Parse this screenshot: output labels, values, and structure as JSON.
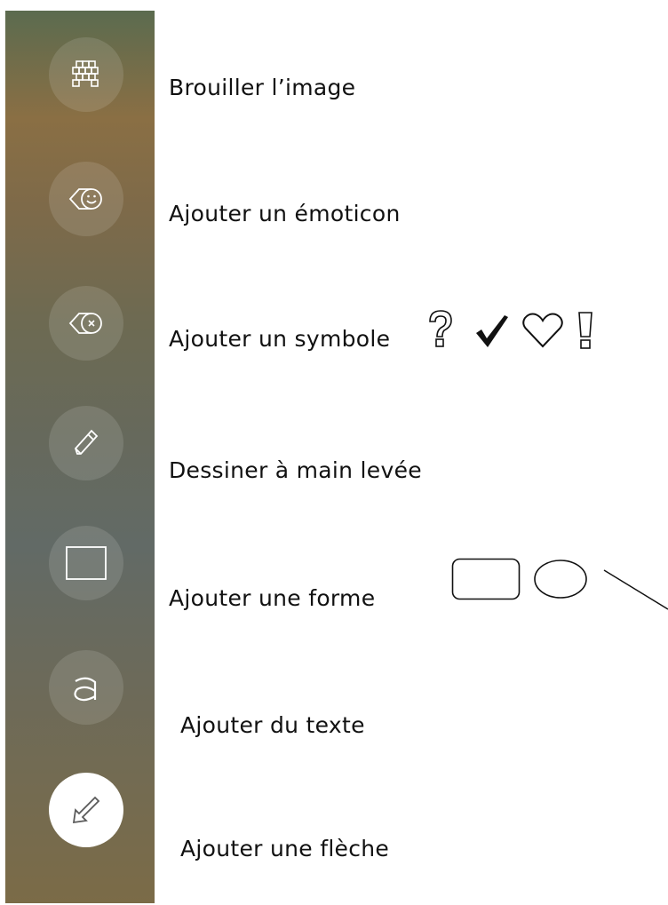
{
  "tools": [
    {
      "id": "blur",
      "label": "Brouiller l’image",
      "icon": "grid-blur-icon",
      "active": false
    },
    {
      "id": "emoticon",
      "label": "Ajouter un émoticon",
      "icon": "emoticon-tag-icon",
      "active": false
    },
    {
      "id": "symbol",
      "label": "Ajouter un symbole",
      "icon": "symbol-tag-icon",
      "active": false
    },
    {
      "id": "draw",
      "label": "Dessiner à main levée",
      "icon": "pencil-icon",
      "active": false
    },
    {
      "id": "shape",
      "label": "Ajouter une forme",
      "icon": "rectangle-icon",
      "active": false
    },
    {
      "id": "text",
      "label": "Ajouter du texte",
      "icon": "letter-a-icon",
      "active": false
    },
    {
      "id": "arrow",
      "label": "Ajouter une flèche",
      "icon": "arrow-icon",
      "active": true
    }
  ],
  "symbol_examples": {
    "question": "?",
    "check": "✓",
    "heart": "♡",
    "exclamation": "!"
  },
  "shape_examples": [
    "rounded-rectangle-icon",
    "ellipse-icon",
    "line-icon"
  ],
  "colors": {
    "sidebar_top": "#8a6f44",
    "sidebar_mid": "#626a66",
    "icon_stroke": "#ffffff",
    "active_bg": "#ffffff",
    "text": "#111111"
  }
}
